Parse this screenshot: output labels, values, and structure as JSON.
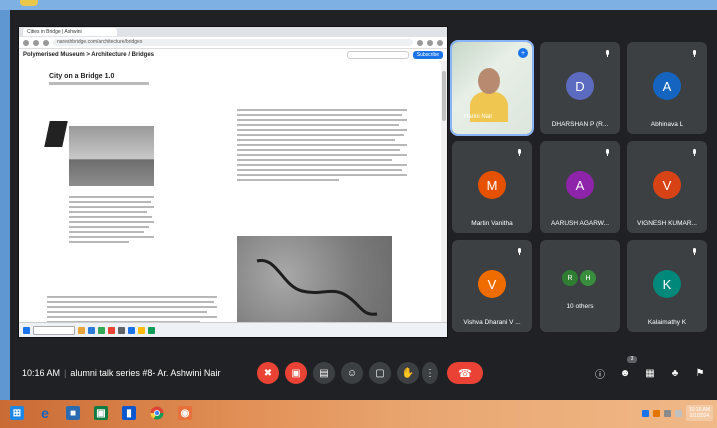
{
  "browser": {
    "tab_title": "Cities in Bridge | Ashwini",
    "url": "nareshbridge.com/architecture/bridges",
    "crumb": "Polymerised Museum > Architecture / Bridges",
    "search_placeholder": "",
    "action_label": "Subscribe"
  },
  "document": {
    "title": "City on a Bridge 1.0"
  },
  "participants": [
    {
      "name": "Harini Nair",
      "initial": "",
      "color": "",
      "self": true
    },
    {
      "name": "DHARSHAN P (R...",
      "initial": "D",
      "color": "#5c6bc0"
    },
    {
      "name": "Abhinava L",
      "initial": "A",
      "color": "#1565c0"
    },
    {
      "name": "Martin Vanitha",
      "initial": "M",
      "color": "#e65100"
    },
    {
      "name": "AARUSH AGARW...",
      "initial": "A",
      "color": "#8e24aa"
    },
    {
      "name": "VIGNESH KUMAR...",
      "initial": "V",
      "color": "#d84315"
    },
    {
      "name": "Vishva Dharani V ...",
      "initial": "V",
      "color": "#ef6c00"
    },
    {
      "name": "10 others",
      "initial": "R",
      "initial2": "H",
      "color": "#2e7d32",
      "color2": "#388e3c"
    },
    {
      "name": "Kalaimathy K",
      "initial": "K",
      "color": "#00897b"
    }
  ],
  "meeting": {
    "time": "10:16 AM",
    "title": "alumni talk series #8- Ar. Ashwini Nair",
    "people_count": "3"
  },
  "windows_tray": {
    "clock_time": "10:16 AM",
    "clock_date": "2/1/2024"
  },
  "icons": {
    "mic_off": "mic-off-icon",
    "cam_off": "camera-off-icon",
    "captions": "captions-icon",
    "emoji": "emoji-icon",
    "present": "present-icon",
    "hand": "hand-icon",
    "more": "more-icon",
    "hangup": "hangup-icon",
    "info": "info-icon",
    "people": "people-icon",
    "chat": "chat-icon",
    "activities": "activities-icon",
    "host": "host-controls-icon"
  }
}
